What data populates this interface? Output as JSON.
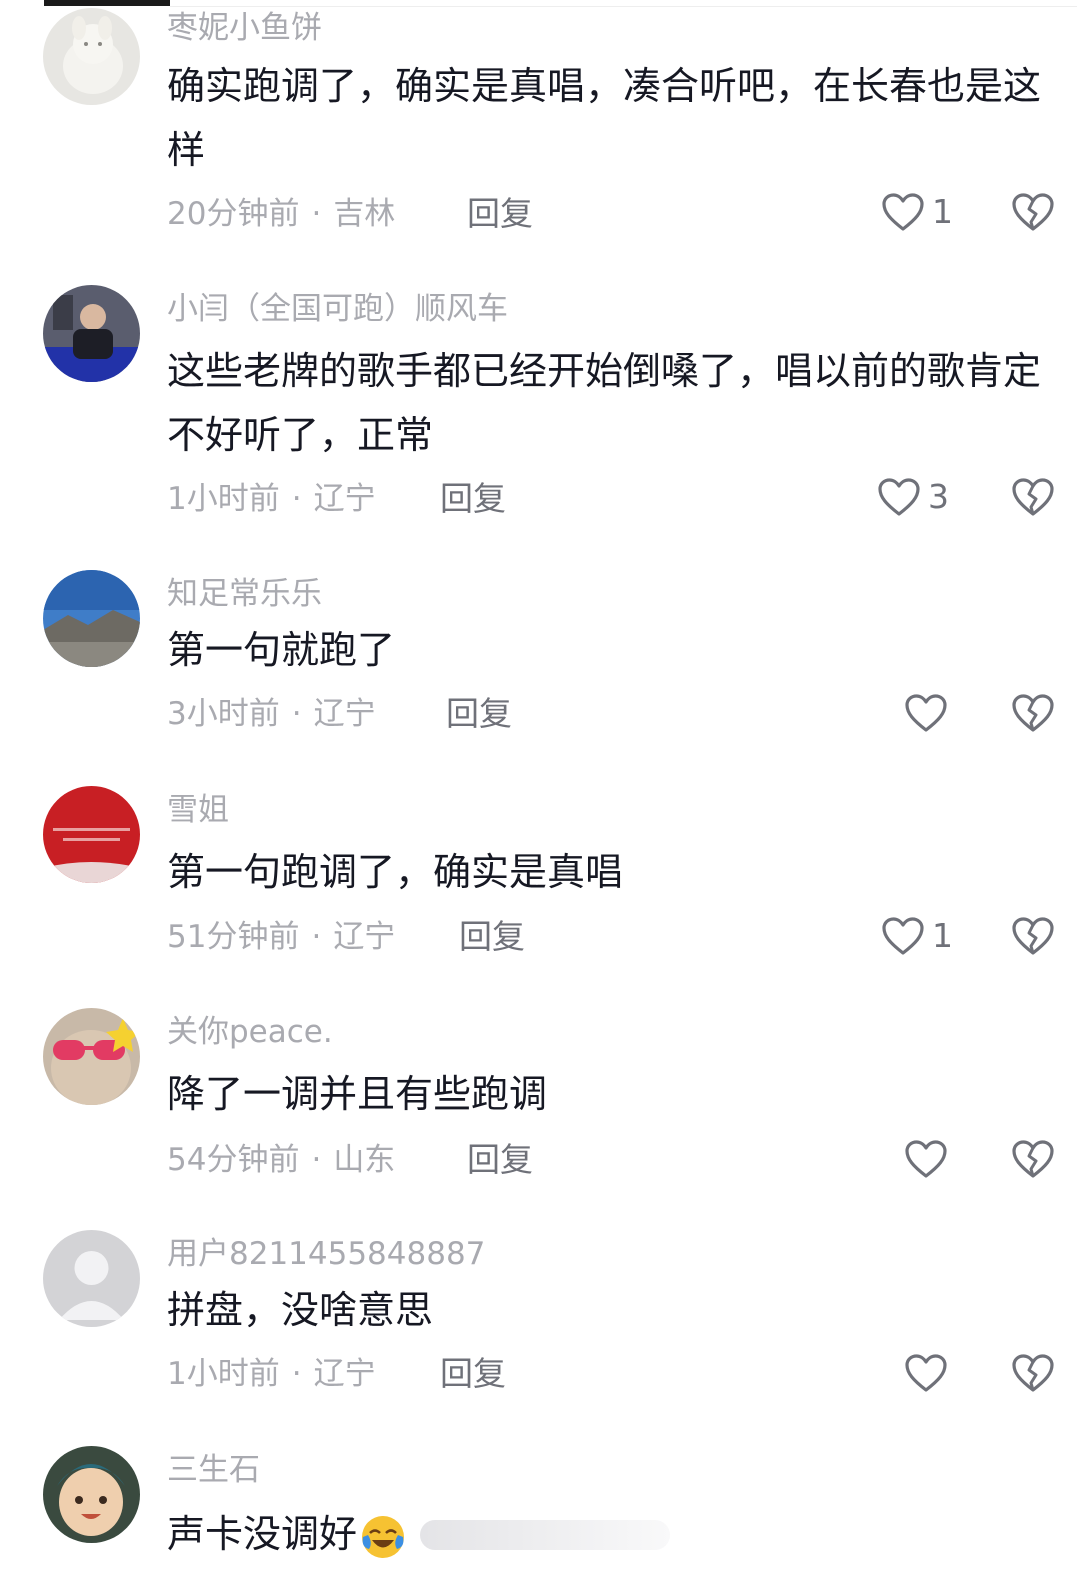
{
  "comments": [
    {
      "username": "枣妮小鱼饼",
      "content": "确实跑调了，确实是真唱，凑合听吧，在长春也是这样",
      "time": "20分钟前",
      "location": "吉林",
      "reply": "回复",
      "likes": "1"
    },
    {
      "username": "小闫（全国可跑）顺风车",
      "content": "这些老牌的歌手都已经开始倒嗓了，唱以前的歌肯定不好听了，正常",
      "time": "1小时前",
      "location": "辽宁",
      "reply": "回复",
      "likes": "3"
    },
    {
      "username": "知足常乐乐",
      "content": "第一句就跑了",
      "time": "3小时前",
      "location": "辽宁",
      "reply": "回复",
      "likes": ""
    },
    {
      "username": "雪姐",
      "content": "第一句跑调了，确实是真唱",
      "time": "51分钟前",
      "location": "辽宁",
      "reply": "回复",
      "likes": "1"
    },
    {
      "username": "关你peace.",
      "content": "降了一调并且有些跑调",
      "time": "54分钟前",
      "location": "山东",
      "reply": "回复",
      "likes": ""
    },
    {
      "username": "用户8211455848887",
      "content": "拼盘，没啥意思",
      "time": "1小时前",
      "location": "辽宁",
      "reply": "回复",
      "likes": ""
    },
    {
      "username": "三生石",
      "content": "声卡没调好",
      "emoji": "crying-laughing-emoji"
    }
  ],
  "meta_separator": "·",
  "icons": {
    "like": "heart-outline-icon",
    "dislike": "broken-heart-icon"
  },
  "colors": {
    "text_primary": "#161823",
    "text_secondary": "#a9aab0",
    "action_text": "#6f7179"
  }
}
